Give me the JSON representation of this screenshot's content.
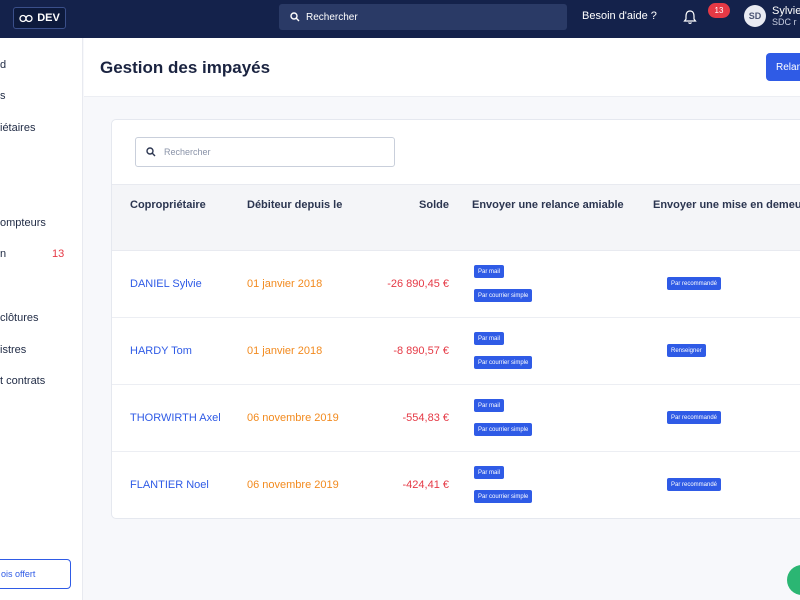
{
  "topbar": {
    "env": "DEV",
    "search_label": "Rechercher",
    "help": "Besoin d'aide ?",
    "notif_count": "13",
    "avatar_initials": "SD",
    "user_name": "Sylvie",
    "user_org": "SDC r"
  },
  "sidebar": {
    "items": [
      {
        "label": "d"
      },
      {
        "label": "s"
      },
      {
        "label": "iétaires"
      },
      {
        "label": "ompteurs"
      },
      {
        "label": "n",
        "count": "13"
      },
      {
        "label": "clôtures"
      },
      {
        "label": "istres"
      },
      {
        "label": "t contrats"
      }
    ],
    "offer": "ois offert"
  },
  "header": {
    "title": "Gestion des impayés",
    "action": "Relancer"
  },
  "table": {
    "search_placeholder": "Rechercher",
    "columns": [
      "Copropriétaire",
      "Débiteur depuis le",
      "Solde",
      "Envoyer une relance amiable",
      "Envoyer une mise en demeure"
    ],
    "rows": [
      {
        "owner": "DANIEL Sylvie",
        "since": "01 janvier 2018",
        "balance": "-26 890,45 €",
        "mail": "Par mail",
        "simple": "Par courrier simple",
        "demeure": "Par recommandé"
      },
      {
        "owner": "HARDY Tom",
        "since": "01 janvier 2018",
        "balance": "-8 890,57 €",
        "mail": "Par mail",
        "simple": "Par courrier simple",
        "demeure": "Renseigner"
      },
      {
        "owner": "THORWIRTH Axel",
        "since": "06 novembre 2019",
        "balance": "-554,83 €",
        "mail": "Par mail",
        "simple": "Par courrier simple",
        "demeure": "Par recommandé"
      },
      {
        "owner": "FLANTIER Noel",
        "since": "06 novembre 2019",
        "balance": "-424,41 €",
        "mail": "Par mail",
        "simple": "Par courrier simple",
        "demeure": "Par recommandé"
      }
    ]
  },
  "colors": {
    "navy": "#14224b",
    "accent": "#2f5be6",
    "danger": "#e53945",
    "warning": "#f28a1e",
    "success": "#2bb673"
  },
  "icons": [
    "link-icon",
    "search-icon",
    "bell-icon",
    "help-fab-icon"
  ]
}
